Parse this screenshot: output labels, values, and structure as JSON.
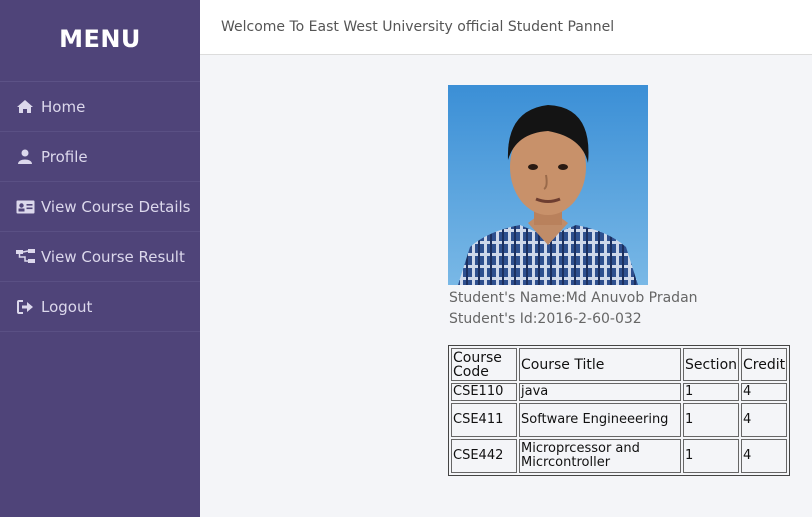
{
  "sidebar": {
    "title": "MENU",
    "items": [
      {
        "label": "Home",
        "icon": "home-icon"
      },
      {
        "label": "Profile",
        "icon": "user-icon"
      },
      {
        "label": "View Course Details",
        "icon": "id-card-icon"
      },
      {
        "label": "View Course Result",
        "icon": "sitemap-icon"
      },
      {
        "label": "Logout",
        "icon": "sign-out-icon"
      }
    ]
  },
  "header": {
    "welcome": "Welcome To East West University official Student Pannel"
  },
  "student": {
    "name_line": "Student's Name:Md Anuvob Pradan",
    "id_line": "Student's Id:2016-2-60-032"
  },
  "table": {
    "headers": [
      "Course Code",
      "Course Title",
      "Section",
      "Credit"
    ],
    "rows": [
      [
        "CSE110",
        "java",
        "1",
        "4"
      ],
      [
        "CSE411",
        "Software Engineeering",
        "1",
        "4"
      ],
      [
        "CSE442",
        "Microprcessor and Micrcontroller",
        "1",
        "4"
      ]
    ]
  },
  "colors": {
    "sidebar": "#4f4479",
    "sidebar_text": "#dcd8ec",
    "page_bg": "#f4f5f8"
  }
}
